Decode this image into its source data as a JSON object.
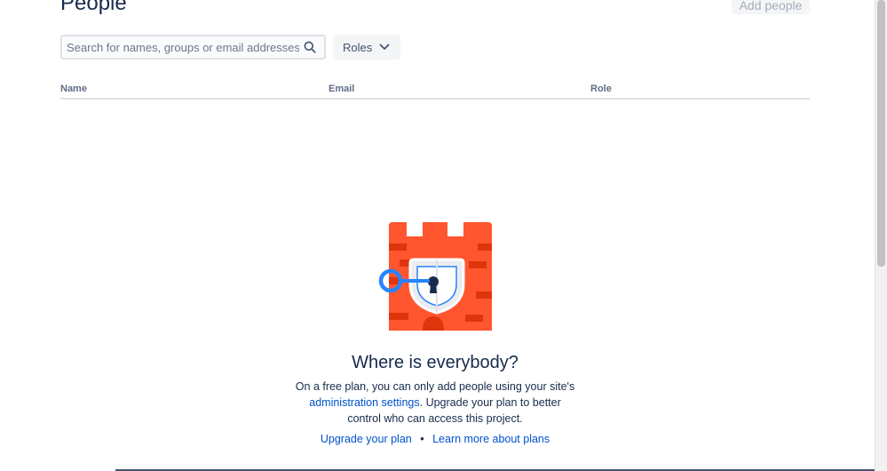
{
  "header": {
    "title": "People",
    "add_people_label": "Add people"
  },
  "filters": {
    "search_placeholder": "Search for names, groups or email addresses",
    "roles_label": "Roles"
  },
  "table": {
    "columns": [
      "Name",
      "Email",
      "Role"
    ]
  },
  "empty_state": {
    "title": "Where is everybody?",
    "desc_before": "On a free plan, you can only add people using your site's ",
    "desc_link": "administration settings",
    "desc_after": ". Upgrade your plan to better control who can access this project.",
    "separator": "•",
    "action_upgrade": "Upgrade your plan",
    "action_learn": "Learn more about plans"
  },
  "colors": {
    "accent_link": "#0052cc",
    "text_primary": "#172b4d",
    "castle_orange": "#ff5630",
    "castle_dark": "#de350b",
    "key_blue": "#2684ff"
  },
  "icons": [
    "search-icon",
    "chevron-down-icon",
    "castle-lock-illustration"
  ]
}
